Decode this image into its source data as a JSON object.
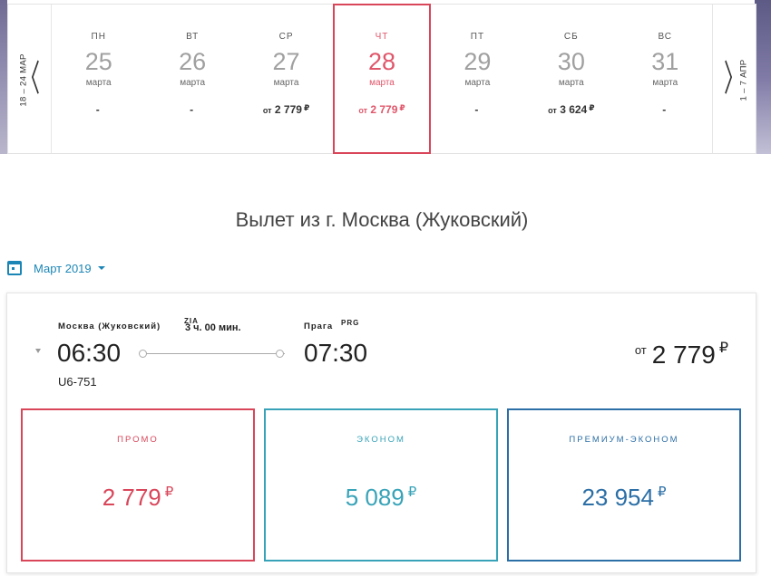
{
  "colors": {
    "accent_red": "#d9465a",
    "accent_teal": "#38a3b8",
    "accent_blue": "#2c6fa6",
    "link_blue": "#1b86b6"
  },
  "date_nav": {
    "prev_range": "18 – 24 МАР",
    "next_range": "1 – 7 АПР",
    "prev_icon": "chevron-left-icon",
    "next_icon": "chevron-right-icon",
    "days": [
      {
        "dow": "ПН",
        "num": "25",
        "month": "марта",
        "price_prefix": "",
        "price": "-",
        "currency": "",
        "selected": false
      },
      {
        "dow": "ВТ",
        "num": "26",
        "month": "марта",
        "price_prefix": "",
        "price": "-",
        "currency": "",
        "selected": false
      },
      {
        "dow": "СР",
        "num": "27",
        "month": "марта",
        "price_prefix": "от",
        "price": "2 779",
        "currency": "₽",
        "selected": false
      },
      {
        "dow": "ЧТ",
        "num": "28",
        "month": "марта",
        "price_prefix": "от",
        "price": "2 779",
        "currency": "₽",
        "selected": true
      },
      {
        "dow": "ПТ",
        "num": "29",
        "month": "марта",
        "price_prefix": "",
        "price": "-",
        "currency": "",
        "selected": false
      },
      {
        "dow": "СБ",
        "num": "30",
        "month": "марта",
        "price_prefix": "от",
        "price": "3 624",
        "currency": "₽",
        "selected": false
      },
      {
        "dow": "ВС",
        "num": "31",
        "month": "марта",
        "price_prefix": "",
        "price": "-",
        "currency": "",
        "selected": false
      }
    ]
  },
  "heading": "Вылет из г. Москва (Жуковский)",
  "month_selector": {
    "label": "Март 2019",
    "icon": "calendar-icon"
  },
  "flight": {
    "from_city": "Москва (Жуковский)",
    "from_code": "ZIA",
    "duration": "3 ч. 00 мин.",
    "dep_time": "06:30",
    "flight_no": "U6-751",
    "to_city": "Прага",
    "to_code": "PRG",
    "arr_time": "07:30",
    "price_prefix": "от",
    "price": "2 779",
    "currency": "₽"
  },
  "fares": [
    {
      "name": "промо",
      "price": "2 779",
      "currency": "₽"
    },
    {
      "name": "эконом",
      "price": "5 089",
      "currency": "₽"
    },
    {
      "name": "премиум-эконом",
      "price": "23 954",
      "currency": "₽"
    }
  ]
}
